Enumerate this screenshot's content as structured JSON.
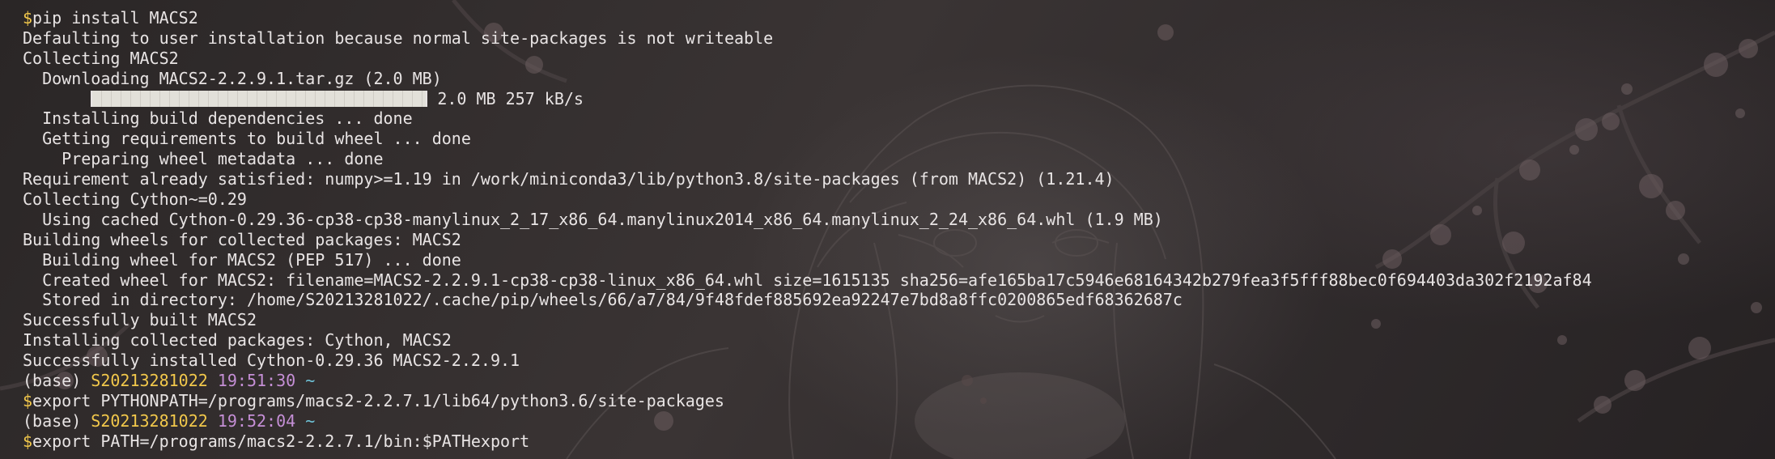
{
  "terminal": {
    "lines": [
      {
        "type": "cmd",
        "dollar": "$",
        "text": "pip install MACS2"
      },
      {
        "type": "text",
        "text": "Defaulting to user installation because normal site-packages is not writeable"
      },
      {
        "type": "text",
        "text": "Collecting MACS2"
      },
      {
        "type": "text",
        "text": "  Downloading MACS2-2.2.9.1.tar.gz (2.0 MB)"
      },
      {
        "type": "progress",
        "indent": "       ",
        "progress": 1.0,
        "suffix": " 2.0 MB 257 kB/s"
      },
      {
        "type": "text",
        "text": "  Installing build dependencies ... done"
      },
      {
        "type": "text",
        "text": "  Getting requirements to build wheel ... done"
      },
      {
        "type": "text",
        "text": "    Preparing wheel metadata ... done"
      },
      {
        "type": "text",
        "text": "Requirement already satisfied: numpy>=1.19 in /work/miniconda3/lib/python3.8/site-packages (from MACS2) (1.21.4)"
      },
      {
        "type": "text",
        "text": "Collecting Cython~=0.29"
      },
      {
        "type": "text",
        "text": "  Using cached Cython-0.29.36-cp38-cp38-manylinux_2_17_x86_64.manylinux2014_x86_64.manylinux_2_24_x86_64.whl (1.9 MB)"
      },
      {
        "type": "text",
        "text": "Building wheels for collected packages: MACS2"
      },
      {
        "type": "text",
        "text": "  Building wheel for MACS2 (PEP 517) ... done"
      },
      {
        "type": "text",
        "text": "  Created wheel for MACS2: filename=MACS2-2.2.9.1-cp38-cp38-linux_x86_64.whl size=1615135 sha256=afe165ba17c5946e68164342b279fea3f5fff88bec0f694403da302f2192af84"
      },
      {
        "type": "text",
        "text": "  Stored in directory: /home/S20213281022/.cache/pip/wheels/66/a7/84/9f48fdef885692ea92247e7bd8a8ffc0200865edf68362687c"
      },
      {
        "type": "text",
        "text": "Successfully built MACS2"
      },
      {
        "type": "text",
        "text": "Installing collected packages: Cython, MACS2"
      },
      {
        "type": "text",
        "text": "Successfully installed Cython-0.29.36 MACS2-2.2.9.1"
      },
      {
        "type": "prompt",
        "env": "(base) ",
        "user": "S20213281022",
        "time": "19:51:30",
        "dir": "~"
      },
      {
        "type": "cmd",
        "dollar": "$",
        "text": "export PYTHONPATH=/programs/macs2-2.2.7.1/lib64/python3.6/site-packages"
      },
      {
        "type": "prompt",
        "env": "(base) ",
        "user": "S20213281022",
        "time": "19:52:04",
        "dir": "~"
      },
      {
        "type": "cmd",
        "dollar": "$",
        "text": "export PATH=/programs/macs2-2.2.7.1/bin:$PATHexport"
      }
    ]
  },
  "theme": {
    "foreground": "#e8e4e4",
    "prompt_yellow": "#f2c84b",
    "time_purple": "#c58fd6",
    "dir_cyan": "#6fc3d8",
    "background": "#2b2727"
  }
}
